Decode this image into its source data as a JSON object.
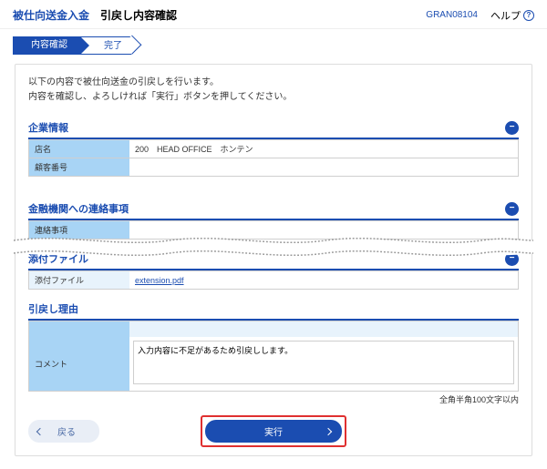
{
  "header": {
    "title_blue": "被仕向送金入金",
    "title_black": "引戻し内容確認",
    "screen_id": "GRAN08104",
    "help_label": "ヘルプ"
  },
  "steps": {
    "active": "内容確認",
    "next": "完了"
  },
  "intro": {
    "line1": "以下の内容で被仕向送金の引戻しを行います。",
    "line2": "内容を確認し、よろしければ「実行」ボタンを押してください。"
  },
  "sections": {
    "company": {
      "title": "企業情報",
      "rows": {
        "branch_label": "店名",
        "branch_value": "200　HEAD OFFICE　ホンテン",
        "custno_label": "顧客番号"
      }
    },
    "fiNote": {
      "title": "金融機関への連絡事項",
      "rows": {
        "note_label": "連絡事項"
      }
    },
    "attach": {
      "title": "添付ファイル",
      "rows": {
        "file_label": "添付ファイル",
        "file_value": "extension.pdf"
      }
    },
    "reason": {
      "title": "引戻し理由",
      "comment_label": "コメント",
      "comment_value": "入力内容に不足があるため引戻しします。",
      "comment_note": "全角半角100文字以内"
    }
  },
  "buttons": {
    "back": "戻る",
    "execute": "実行"
  }
}
